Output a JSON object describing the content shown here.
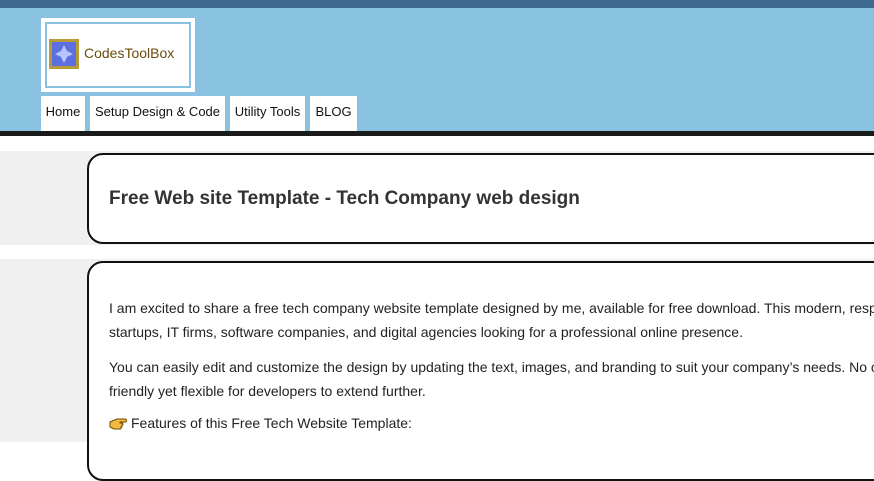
{
  "header": {
    "logo_text": "CodesToolBox",
    "nav": [
      {
        "label": "Home"
      },
      {
        "label": "Setup Design & Code"
      },
      {
        "label": "Utility Tools"
      },
      {
        "label": "BLOG"
      }
    ]
  },
  "page": {
    "title": "Free Web site Template - Tech Company web design"
  },
  "content": {
    "p1_line1": "I am excited to share a free tech company website template designed by me, available for free download. This modern, resp",
    "p1_line2": "startups, IT firms, software companies, and digital agencies looking for a professional online presence.",
    "p2_line1": "You can easily edit and customize the design by updating the text, images, and branding to suit your company’s needs. No c",
    "p2_line2": "friendly yet flexible for developers to extend further.",
    "features_heading": "Features of this Free Tech Website Template:"
  },
  "colors": {
    "header_bg": "#89c2e0",
    "top_strip": "#3e6a8f",
    "logo_text": "#6b4e0a"
  },
  "icons": {
    "logo": "codestoolbox-logo-icon",
    "feature": "pointing-hand-icon"
  }
}
